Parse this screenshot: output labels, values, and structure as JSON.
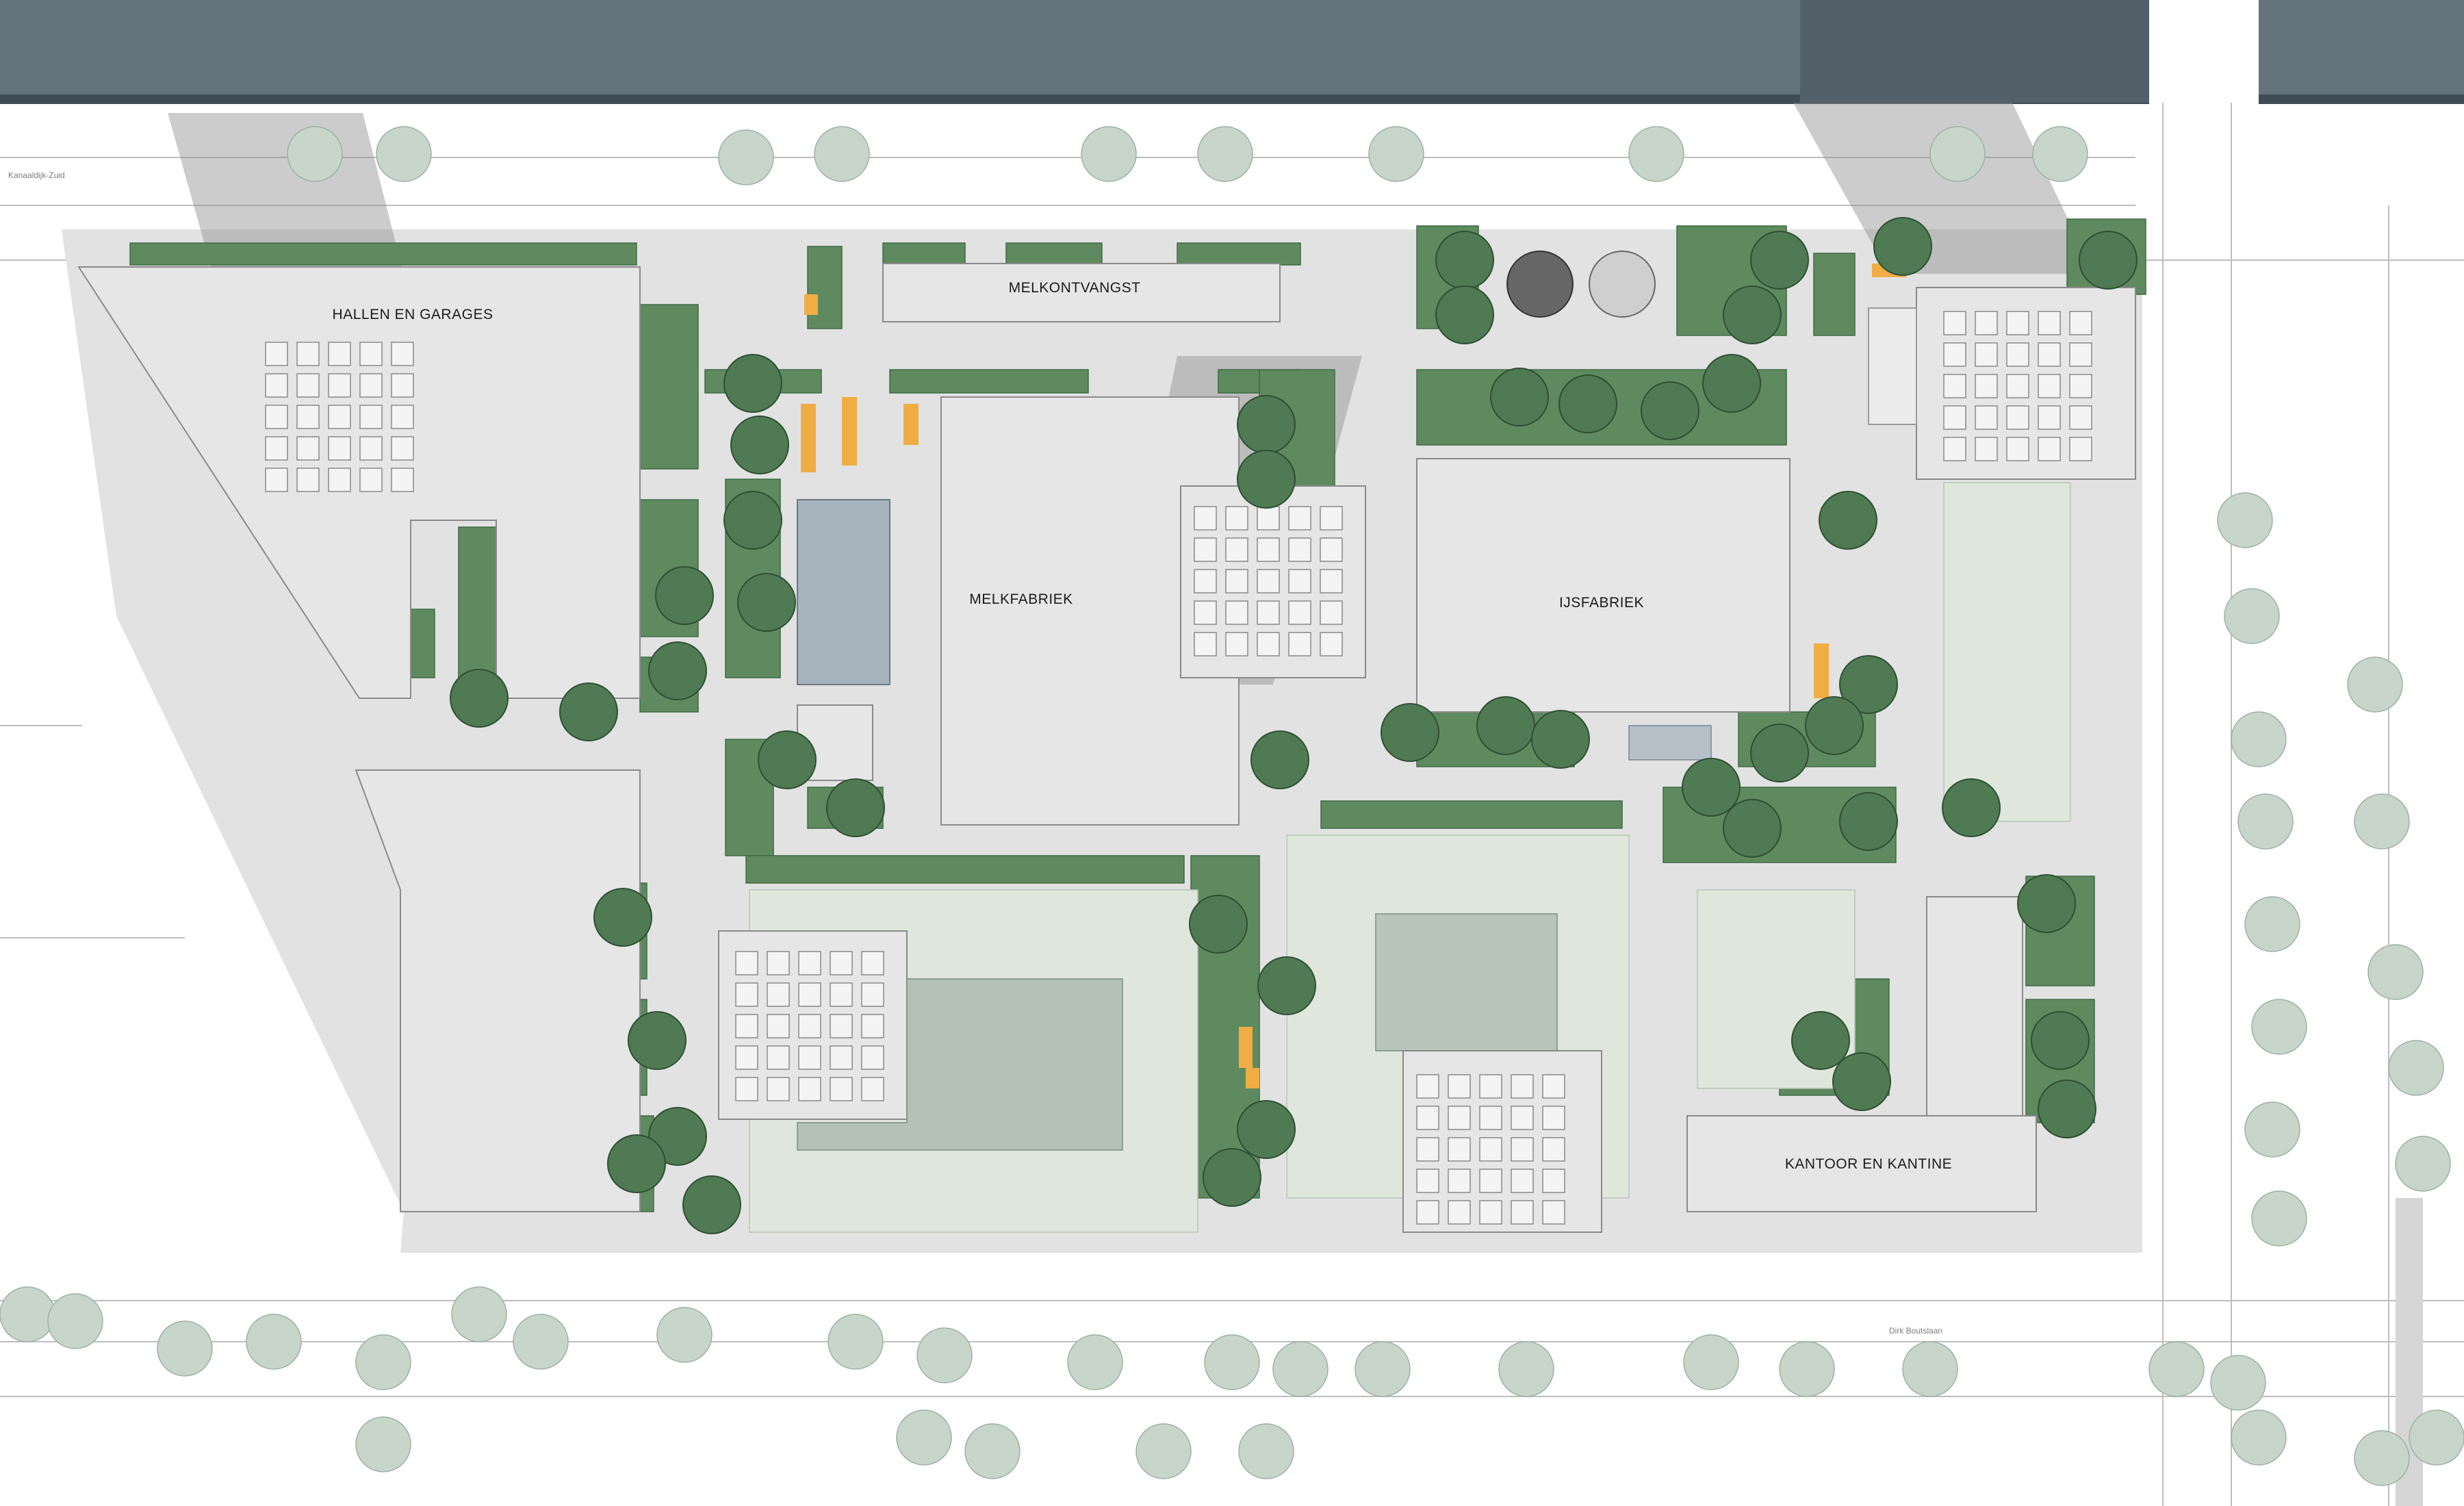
{
  "labels": {
    "hallen": "HALLEN EN GARAGES",
    "melkontvangst": "MELKONTVANGST",
    "melkfabriek": "MELKFABRIEK",
    "ijsfabriek": "IJSFABRIEK",
    "kantoor": "KANTOOR EN KANTINE"
  },
  "streets": {
    "north": "Kanaaldijk-Zuid",
    "south": "Dirk Boutslaan"
  },
  "colors": {
    "water": "#64727b",
    "building": "#e6e6e6",
    "shadow": "#8f8f8f",
    "hedge": "#5f8a5f",
    "tree_dark": "#4f7a53",
    "tree_light": "#c7d5cb",
    "accent": "#f0ad44"
  }
}
